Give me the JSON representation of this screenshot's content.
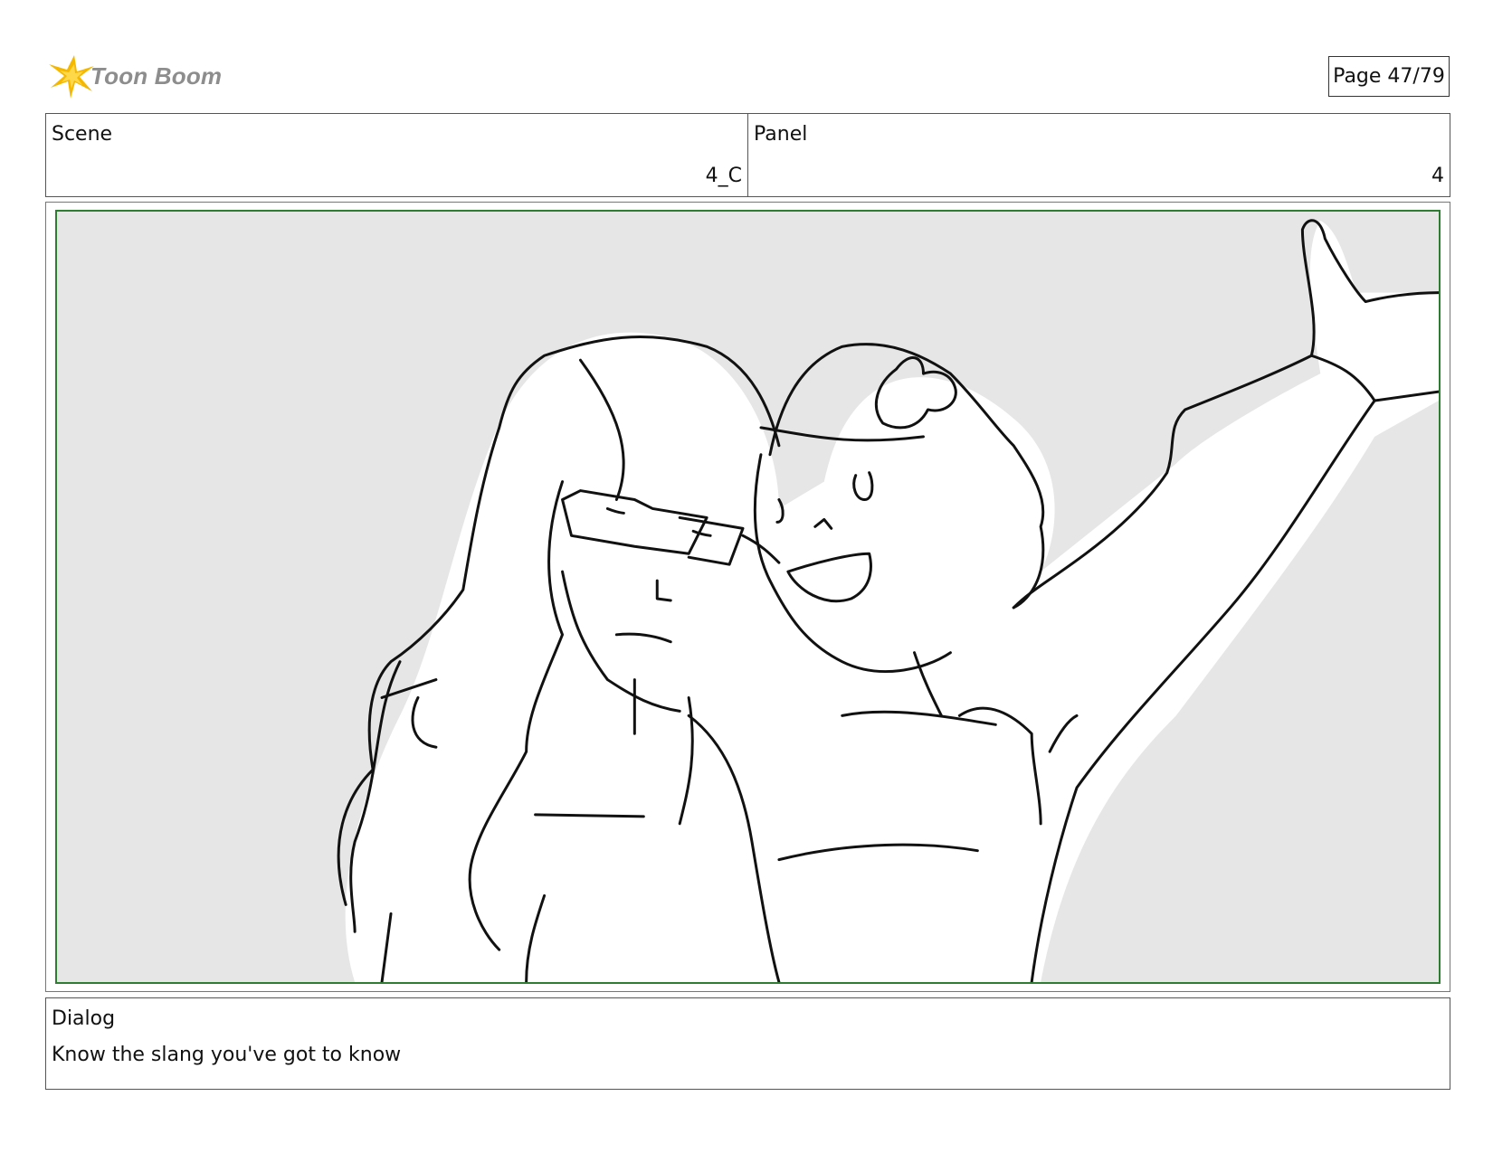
{
  "header": {
    "logo_text": "Toon Boom",
    "page_label": "Page 47/79"
  },
  "scene": {
    "label": "Scene",
    "value": "4_C"
  },
  "panel": {
    "label": "Panel",
    "value": "4"
  },
  "dialog": {
    "label": "Dialog",
    "text": "Know the slang you've got to know"
  },
  "colors": {
    "frame_border": "#2e7d32",
    "panel_background": "#e6e6e6",
    "logo_star": "#f5b800",
    "logo_text": "#8d8d8d"
  },
  "icons": {
    "logo": "toon-boom-star-icon"
  }
}
